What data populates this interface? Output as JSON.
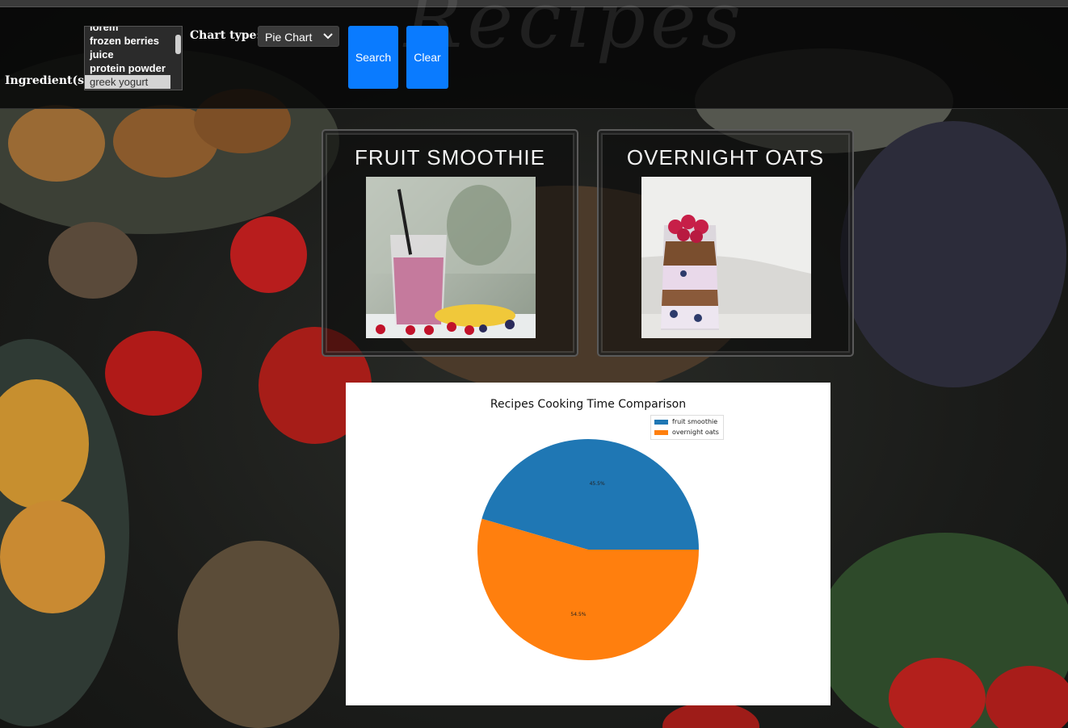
{
  "controls": {
    "ingredients_label": "Ingredient(s):",
    "ingredient_options": [
      {
        "label": "lorem",
        "selected": false
      },
      {
        "label": "frozen berries",
        "selected": false
      },
      {
        "label": "juice",
        "selected": false
      },
      {
        "label": "protein powder",
        "selected": false
      },
      {
        "label": "greek yogurt",
        "selected": true
      }
    ],
    "chart_type_label": "Chart type:",
    "chart_type_value": "Pie Chart",
    "search_label": "Search",
    "clear_label": "Clear",
    "accent_color": "#0a7bff"
  },
  "recipes": [
    {
      "title": "FRUIT SMOOTHIE"
    },
    {
      "title": "OVERNIGHT OATS"
    }
  ],
  "chart_data": {
    "type": "pie",
    "title": "Recipes Cooking Time Comparison",
    "legend_position": "upper-right",
    "slices": [
      {
        "label": "fruit smoothie",
        "value": 45.5,
        "display": "45.5%",
        "color": "#1f77b4"
      },
      {
        "label": "overnight oats",
        "value": 54.5,
        "display": "54.5%",
        "color": "#ff7f0e"
      }
    ]
  }
}
